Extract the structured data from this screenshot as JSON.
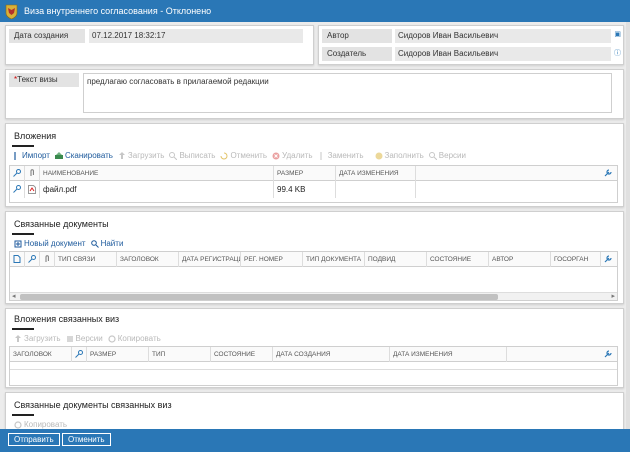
{
  "window": {
    "title": "Виза внутреннего согласования - Отклонено"
  },
  "header": {
    "created_label": "Дата создания",
    "created_value": "07.12.2017 18:32:17",
    "author_label": "Автор",
    "author_value": "Сидоров Иван Васильевич",
    "creator_label": "Создатель",
    "creator_value": "Сидоров Иван Васильевич",
    "visa_text_label": "Текст визы",
    "visa_text_required": "*",
    "visa_text_value": "предлагаю согласовать в прилагаемой редакции"
  },
  "attachments": {
    "title": "Вложения",
    "toolbar": [
      {
        "label": "Импорт",
        "icon": "import-icon",
        "enabled": true
      },
      {
        "label": "Сканировать",
        "icon": "scanner-icon",
        "enabled": true
      },
      {
        "label": "Загрузить",
        "icon": "upload-icon",
        "enabled": false
      },
      {
        "label": "Выписать",
        "icon": "checkout-icon",
        "enabled": false
      },
      {
        "label": "Отменить",
        "icon": "undo-icon",
        "enabled": false
      },
      {
        "label": "Удалить",
        "icon": "delete-icon",
        "enabled": false
      },
      {
        "label": "Заменить",
        "icon": "replace-icon",
        "enabled": false
      },
      {
        "label": "Заполнить",
        "icon": "fill-icon",
        "enabled": false
      },
      {
        "label": "Версии",
        "icon": "versions-icon",
        "enabled": false
      }
    ],
    "columns": [
      "Наименование",
      "Размер",
      "Дата изменения"
    ],
    "rows": [
      {
        "name": "файл.pdf",
        "size": "99.4 KB",
        "modified": ""
      }
    ]
  },
  "related_docs": {
    "title": "Связанные документы",
    "toolbar": [
      {
        "label": "Новый документ",
        "icon": "new-document-icon",
        "enabled": true
      },
      {
        "label": "Найти",
        "icon": "search-icon",
        "enabled": true
      }
    ],
    "columns": [
      "Тип связи",
      "Заголовок",
      "Дата регистрации",
      "Рег. номер",
      "Тип документа",
      "Подвид",
      "Состояние",
      "Автор",
      "Госорган"
    ]
  },
  "related_visa_attachments": {
    "title": "Вложения связанных виз",
    "toolbar": [
      {
        "label": "Загрузить",
        "icon": "upload-icon",
        "enabled": false
      },
      {
        "label": "Версии",
        "icon": "versions-icon",
        "enabled": false
      },
      {
        "label": "Копировать",
        "icon": "copy-icon",
        "enabled": false
      }
    ],
    "columns": [
      "Заголовок",
      "Размер",
      "Тип",
      "Состояние",
      "Дата создания",
      "Дата изменения"
    ]
  },
  "related_visa_docs": {
    "title": "Связанные документы связанных виз",
    "toolbar": [
      {
        "label": "Копировать",
        "icon": "copy-icon",
        "enabled": false
      }
    ]
  },
  "footer": {
    "send_label": "Отправить",
    "cancel_label": "Отменить"
  }
}
